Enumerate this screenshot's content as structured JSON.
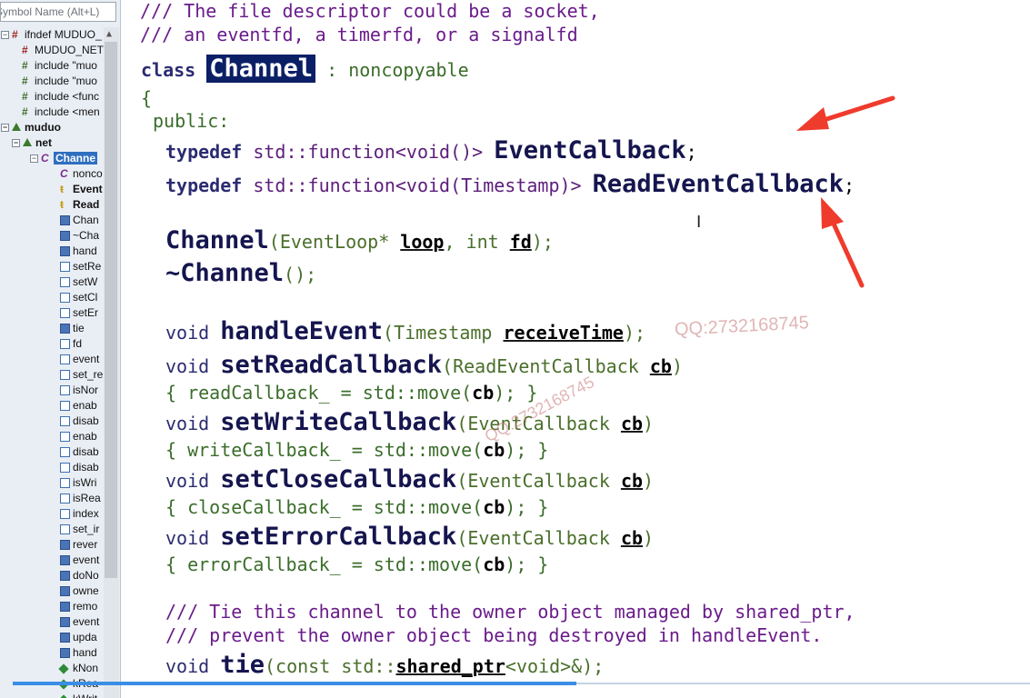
{
  "search": {
    "placeholder": "Symbol Name (Alt+L)"
  },
  "tree": [
    {
      "icon": "ifdef-icon",
      "label": "ifndef MUDUO_",
      "indent": 0,
      "expander": "⊟",
      "kind": "hash"
    },
    {
      "icon": "define-icon",
      "label": "MUDUO_NET",
      "indent": 1,
      "kind": "hash"
    },
    {
      "icon": "include-icon",
      "label": "include \"muo",
      "indent": 1,
      "kind": "inc"
    },
    {
      "icon": "include-icon",
      "label": "include \"muo",
      "indent": 1,
      "kind": "inc"
    },
    {
      "icon": "include-icon",
      "label": "include <func",
      "indent": 1,
      "kind": "inc"
    },
    {
      "icon": "include-icon",
      "label": "include <men",
      "indent": 1,
      "kind": "inc"
    },
    {
      "icon": "namespace-icon",
      "label": "muduo",
      "indent": 0,
      "expander": "⊟",
      "kind": "ns",
      "bold": true
    },
    {
      "icon": "namespace-icon",
      "label": "net",
      "indent": 1,
      "expander": "⊟",
      "kind": "ns",
      "bold": true
    },
    {
      "icon": "class-icon",
      "label": "Channe",
      "indent": 2,
      "expander": "⊟",
      "kind": "class",
      "selected": true
    },
    {
      "icon": "class-icon",
      "label": "nonco",
      "indent": 3,
      "kind": "class"
    },
    {
      "icon": "typedef-icon",
      "label": "Event",
      "indent": 3,
      "kind": "type",
      "bold": true
    },
    {
      "icon": "typedef-icon",
      "label": "Read",
      "indent": 3,
      "kind": "type",
      "bold": true
    },
    {
      "icon": "method-icon",
      "label": "Chan",
      "indent": 3,
      "kind": "method"
    },
    {
      "icon": "method-icon",
      "label": "~Cha",
      "indent": 3,
      "kind": "method"
    },
    {
      "icon": "method-icon",
      "label": "hand",
      "indent": 3,
      "kind": "method"
    },
    {
      "icon": "method-icon",
      "label": "setRe",
      "indent": 3,
      "kind": "member"
    },
    {
      "icon": "method-icon",
      "label": "setW",
      "indent": 3,
      "kind": "member"
    },
    {
      "icon": "method-icon",
      "label": "setCl",
      "indent": 3,
      "kind": "member"
    },
    {
      "icon": "method-icon",
      "label": "setEr",
      "indent": 3,
      "kind": "member"
    },
    {
      "icon": "method-icon",
      "label": "tie",
      "indent": 3,
      "kind": "method"
    },
    {
      "icon": "method-icon",
      "label": "fd",
      "indent": 3,
      "kind": "member"
    },
    {
      "icon": "method-icon",
      "label": "event",
      "indent": 3,
      "kind": "member"
    },
    {
      "icon": "method-icon",
      "label": "set_re",
      "indent": 3,
      "kind": "member"
    },
    {
      "icon": "method-icon",
      "label": "isNor",
      "indent": 3,
      "kind": "member"
    },
    {
      "icon": "method-icon",
      "label": "enab",
      "indent": 3,
      "kind": "member"
    },
    {
      "icon": "method-icon",
      "label": "disab",
      "indent": 3,
      "kind": "member"
    },
    {
      "icon": "method-icon",
      "label": "enab",
      "indent": 3,
      "kind": "member"
    },
    {
      "icon": "method-icon",
      "label": "disab",
      "indent": 3,
      "kind": "member"
    },
    {
      "icon": "method-icon",
      "label": "disab",
      "indent": 3,
      "kind": "member"
    },
    {
      "icon": "method-icon",
      "label": "isWri",
      "indent": 3,
      "kind": "member"
    },
    {
      "icon": "method-icon",
      "label": "isRea",
      "indent": 3,
      "kind": "member"
    },
    {
      "icon": "method-icon",
      "label": "index",
      "indent": 3,
      "kind": "member"
    },
    {
      "icon": "method-icon",
      "label": "set_ir",
      "indent": 3,
      "kind": "member"
    },
    {
      "icon": "method-icon",
      "label": "rever",
      "indent": 3,
      "kind": "method"
    },
    {
      "icon": "method-icon",
      "label": "event",
      "indent": 3,
      "kind": "method"
    },
    {
      "icon": "method-icon",
      "label": "doNo",
      "indent": 3,
      "kind": "method"
    },
    {
      "icon": "method-icon",
      "label": "owne",
      "indent": 3,
      "kind": "method"
    },
    {
      "icon": "method-icon",
      "label": "remo",
      "indent": 3,
      "kind": "method"
    },
    {
      "icon": "method-icon",
      "label": "event",
      "indent": 3,
      "kind": "method"
    },
    {
      "icon": "method-icon",
      "label": "upda",
      "indent": 3,
      "kind": "method"
    },
    {
      "icon": "method-icon",
      "label": "hand",
      "indent": 3,
      "kind": "method"
    },
    {
      "icon": "constant-icon",
      "label": "kNon",
      "indent": 3,
      "kind": "diamond"
    },
    {
      "icon": "constant-icon",
      "label": "kRea",
      "indent": 3,
      "kind": "diamond"
    },
    {
      "icon": "constant-icon",
      "label": "kWrit",
      "indent": 3,
      "kind": "diamond"
    }
  ],
  "code": {
    "c1": "/// The file descriptor could be a socket,",
    "c2": "/// an eventfd, a timerfd, or a signalfd",
    "class_kw": "class",
    "class_name": "Channel",
    "class_base": ": noncopyable",
    "brace_open": "{",
    "access": "public:",
    "t1_kw": "typedef",
    "t1_sig": "std::function<void()>",
    "t1_name": "EventCallback",
    "t2_kw": "typedef",
    "t2_sig": "std::function<void(Timestamp)>",
    "t2_name": "ReadEventCallback",
    "semi": ";",
    "ctor_name": "Channel",
    "ctor_p1": "(EventLoop*",
    "ctor_loop": "loop",
    "ctor_mid": ", int",
    "ctor_fd": "fd",
    "ctor_end": ");",
    "dtor_name": "~Channel",
    "dtor_end": "();",
    "void": "void",
    "he_name": "handleEvent",
    "he_p": "(Timestamp",
    "he_arg": "receiveTime",
    "he_end": ");",
    "sr_name": "setReadCallback",
    "sr_p": "(ReadEventCallback",
    "cb": "cb",
    "close_paren": ")",
    "sr_body_a": "{ readCallback_ = std::move(",
    "body_end": "); }",
    "sw_name": "setWriteCallback",
    "ec_p": "(EventCallback",
    "sw_body_a": "{ writeCallback_ = std::move(",
    "sc_name": "setCloseCallback",
    "sc_body_a": "{ closeCallback_ = std::move(",
    "se_name": "setErrorCallback",
    "se_body_a": "{ errorCallback_ = std::move(",
    "c3": "/// Tie this channel to the owner object managed by shared_ptr,",
    "c4": "/// prevent the owner object being destroyed in handleEvent.",
    "tie_name": "tie",
    "tie_p": "(const std::",
    "tie_sp": "shared_ptr",
    "tie_end": "<void>&);"
  },
  "watermark": {
    "a": "QQ:2732168745",
    "b": "QQ:2732168745"
  },
  "colors": {
    "selection": "#0b1f66",
    "arrow": "#ef3b2c",
    "progress": "#3a8ee6"
  }
}
